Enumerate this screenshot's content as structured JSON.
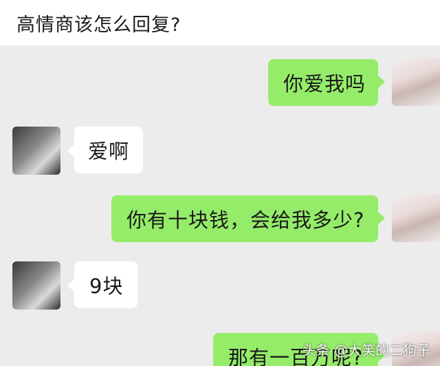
{
  "header": {
    "title": "高情商该怎么回复?"
  },
  "messages": [
    {
      "side": "sent",
      "text": "你爱我吗"
    },
    {
      "side": "recv",
      "text": "爱啊"
    },
    {
      "side": "sent",
      "text": "你有十块钱，会给我多少?"
    },
    {
      "side": "recv",
      "text": "9块"
    },
    {
      "side": "sent",
      "text": "那有一百万呢?"
    }
  ],
  "watermark": {
    "text": "头条 @大笑的二狗子"
  },
  "colors": {
    "sent_bubble": "#95ec69",
    "recv_bubble": "#ffffff",
    "chat_background": "#ececec"
  }
}
